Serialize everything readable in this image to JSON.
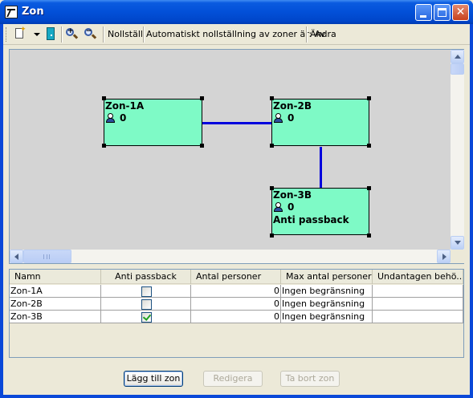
{
  "window": {
    "title": "Zon",
    "minimize_label": "",
    "maximize_label": "",
    "close_label": "✕"
  },
  "toolbar": {
    "new_icon": "new-document-icon",
    "door_icon": "door-icon",
    "zoom_in_icon": "zoom-in-icon",
    "zoom_out_icon": "zoom-out-icon",
    "reset_label": "Nollställ",
    "auto_reset_text": "Automatiskt nollställning av zoner är: Av",
    "change_label": "Ändra"
  },
  "diagram": {
    "zones": [
      {
        "name": "Zon-1A",
        "count": "0",
        "extra": ""
      },
      {
        "name": "Zon-2B",
        "count": "0",
        "extra": ""
      },
      {
        "name": "Zon-3B",
        "count": "0",
        "extra": "Anti passback"
      }
    ],
    "zone_color": "#7EFAC6",
    "link_color": "#0000DD",
    "background_color": "#D4D4D4"
  },
  "grid": {
    "columns": [
      "Namn",
      "Anti passback",
      "Antal personer",
      "Max antal personer",
      "Undantagen behö..."
    ],
    "rows": [
      {
        "name": "Zon-1A",
        "anti_passback": false,
        "count": "0",
        "max": "Ingen begränsning",
        "exempt": ""
      },
      {
        "name": "Zon-2B",
        "anti_passback": false,
        "count": "0",
        "max": "Ingen begränsning",
        "exempt": ""
      },
      {
        "name": "Zon-3B",
        "anti_passback": true,
        "count": "0",
        "max": "Ingen begränsning",
        "exempt": ""
      }
    ]
  },
  "buttons": {
    "add_zone": "Lägg till zon",
    "edit": "Redigera",
    "remove_zone": "Ta bort zon"
  }
}
